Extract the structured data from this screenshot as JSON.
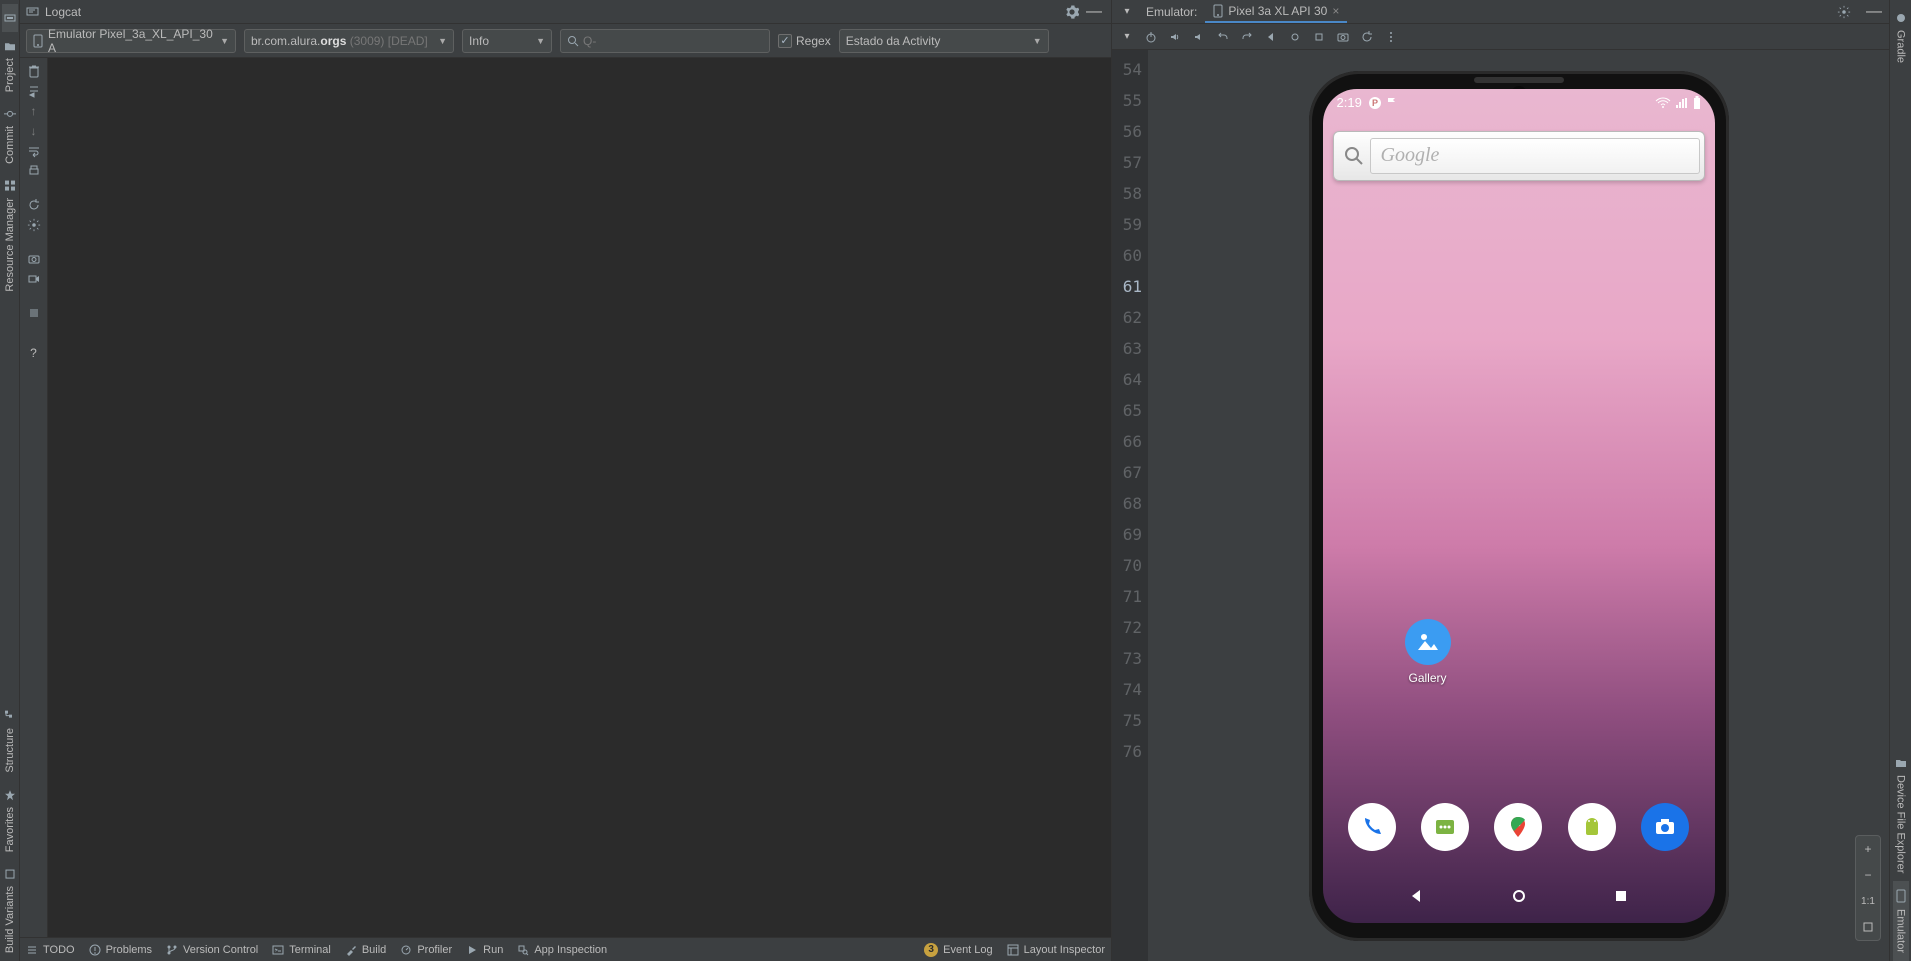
{
  "left_tabs": {
    "project": "Project",
    "commit": "Commit",
    "resource_manager": "Resource Manager",
    "structure": "Structure",
    "favorites": "Favorites",
    "build_variants": "Build Variants"
  },
  "logcat": {
    "title": "Logcat",
    "device": "Emulator Pixel_3a_XL_API_30 A",
    "package_prefix": "br.com.alura.",
    "package_bold": "orgs",
    "package_suffix": " (3009) [DEAD]",
    "level": "Info",
    "search_placeholder": "Q-",
    "regex_label": "Regex",
    "filter": "Estado da Activity"
  },
  "gutter": {
    "start": 54,
    "end": 76,
    "current": 61
  },
  "emulator": {
    "title": "Emulator:",
    "tab": "Pixel 3a XL API 30"
  },
  "right_tabs": {
    "gradle": "Gradle",
    "device_file_explorer": "Device File Explorer",
    "emulator": "Emulator"
  },
  "phone": {
    "time": "2:19",
    "search_placeholder": "Google",
    "gallery_label": "Gallery"
  },
  "zoom_label": "1:1",
  "bottom": {
    "todo": "TODO",
    "problems": "Problems",
    "vcs": "Version Control",
    "terminal": "Terminal",
    "build": "Build",
    "profiler": "Profiler",
    "run": "Run",
    "app_inspection": "App Inspection",
    "event_log": "Event Log",
    "layout_inspector": "Layout Inspector"
  }
}
